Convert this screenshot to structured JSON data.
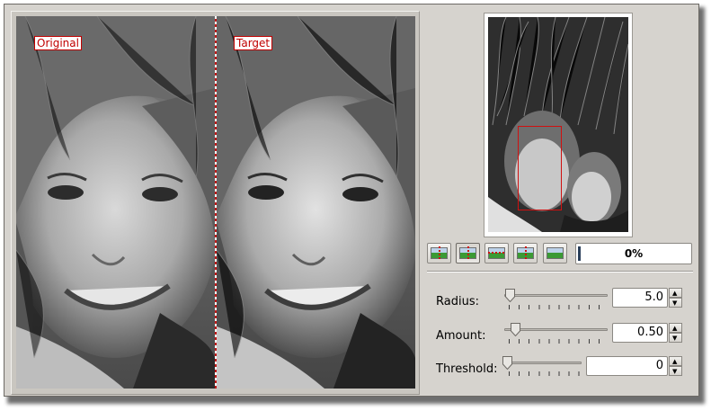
{
  "preview": {
    "left_label": "Original",
    "right_label": "Target"
  },
  "navigator": {
    "icon": "navigator-thumbnail"
  },
  "toolbar": {
    "buttons": [
      {
        "name": "orientation-toggle-icon"
      },
      {
        "name": "split-vertical-icon"
      },
      {
        "name": "split-horizontal-icon"
      },
      {
        "name": "split-vertical-dup-icon"
      },
      {
        "name": "preview-full-icon"
      }
    ],
    "progress_text": "0%",
    "progress_value": 0
  },
  "settings": {
    "radius": {
      "label": "Radius:",
      "value": "5.0"
    },
    "amount": {
      "label": "Amount:",
      "value": "0.50"
    },
    "threshold": {
      "label": "Threshold:",
      "value": "0"
    }
  },
  "colors": {
    "window_bg": "#d6d3ce",
    "marker_red": "#c00000"
  }
}
